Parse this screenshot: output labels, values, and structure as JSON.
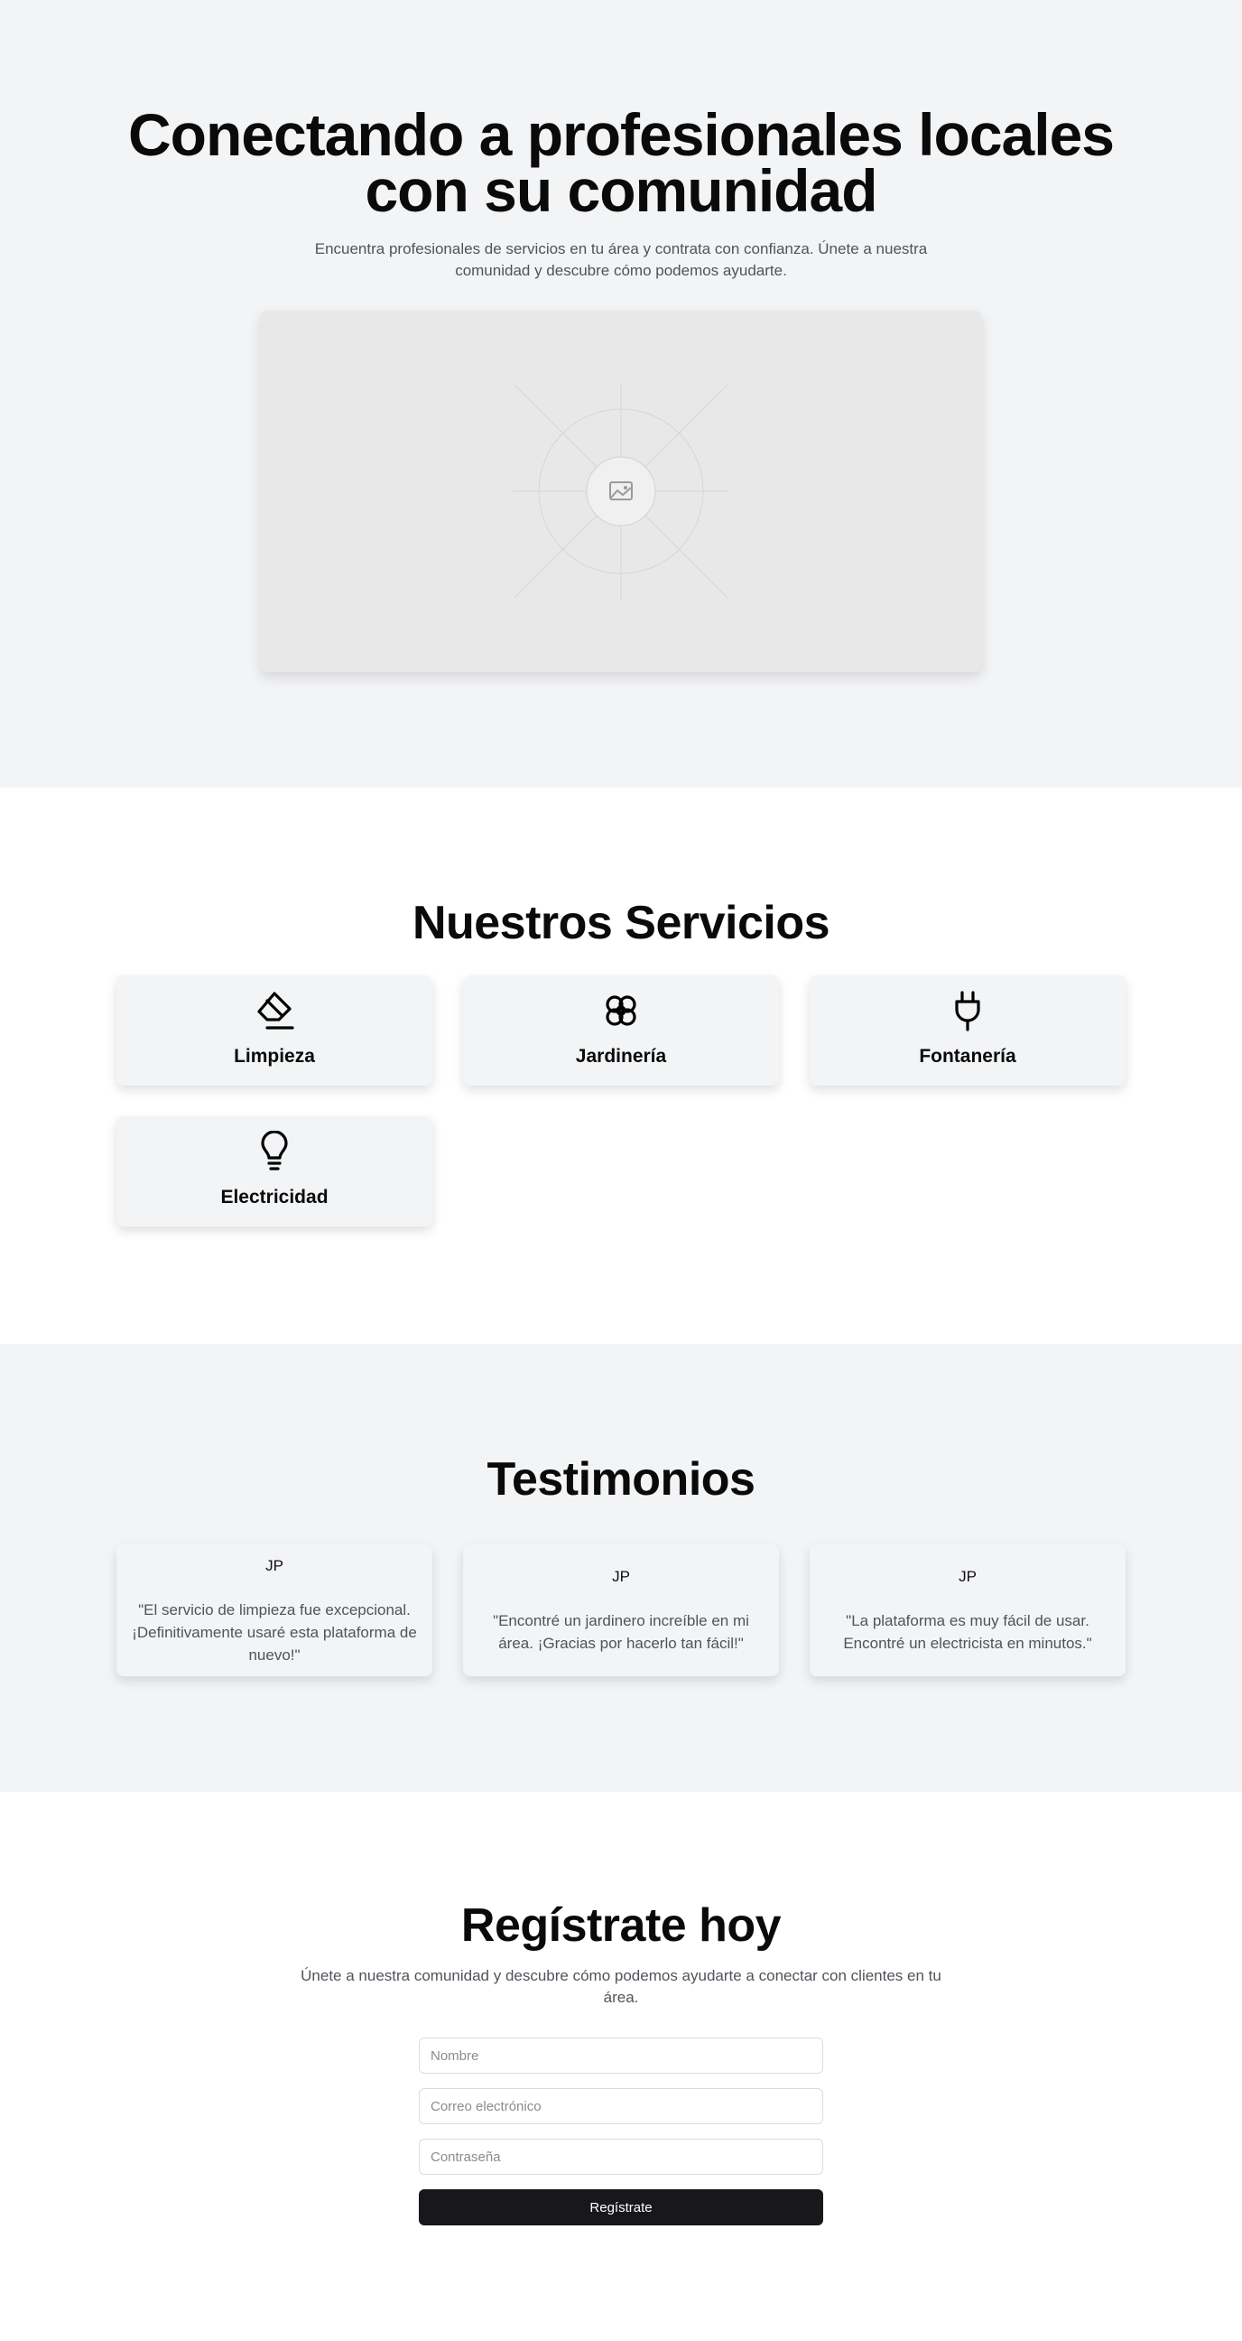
{
  "hero": {
    "title_line1": "Conectando a profesionales locales",
    "title_line2": "con su comunidad",
    "subtitle_line1": "Encuentra profesionales de servicios en tu área y contrata con confianza. Únete a nuestra",
    "subtitle_line2": "comunidad y descubre cómo podemos ayudarte.",
    "image_icon": "image-placeholder-icon"
  },
  "services": {
    "title": "Nuestros Servicios",
    "items": [
      {
        "label": "Limpieza",
        "icon": "eraser-icon"
      },
      {
        "label": "Jardinería",
        "icon": "flower-icon"
      },
      {
        "label": "Fontanería",
        "icon": "plug-icon"
      },
      {
        "label": "Electricidad",
        "icon": "lightbulb-icon"
      }
    ]
  },
  "testimonials": {
    "title": "Testimonios",
    "items": [
      {
        "initials": "JP",
        "quote_line1": "\"El servicio de limpieza fue excepcional.",
        "quote_line2": "¡Definitivamente usaré esta plataforma de",
        "quote_line3": "nuevo!\""
      },
      {
        "initials": "JP",
        "quote_line1": "\"Encontré un jardinero increíble en mi",
        "quote_line2": "área. ¡Gracias por hacerlo tan fácil!\""
      },
      {
        "initials": "JP",
        "quote_line1": "\"La plataforma es muy fácil de usar.",
        "quote_line2": "Encontré un electricista en minutos.\""
      }
    ]
  },
  "register": {
    "title": "Regístrate hoy",
    "subtitle_line1": "Únete a nuestra comunidad y descubre cómo podemos ayudarte a conectar con clientes en tu",
    "subtitle_line2": "área.",
    "name_placeholder": "Nombre",
    "email_placeholder": "Correo electrónico",
    "password_placeholder": "Contraseña",
    "submit_label": "Regístrate"
  },
  "colors": {
    "section_bg": "#f3f4f6",
    "text_primary": "#0a0a0a",
    "text_muted": "#52525b",
    "button_bg": "#18181b"
  }
}
